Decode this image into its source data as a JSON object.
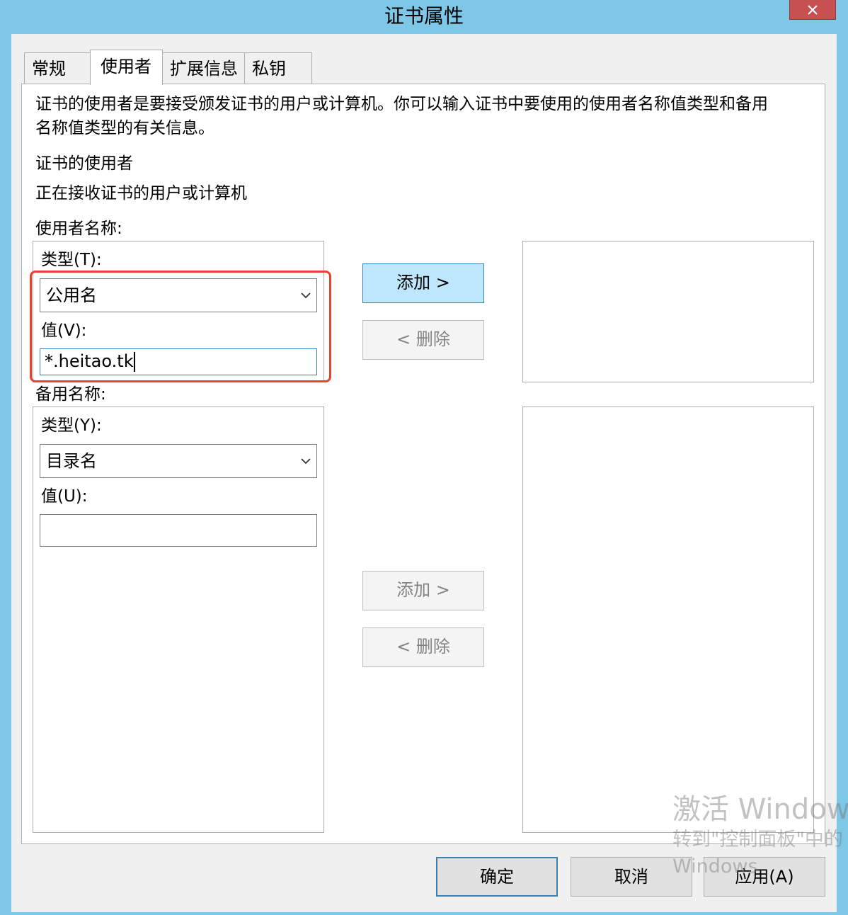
{
  "window": {
    "title": "证书属性",
    "close_glyph": "x"
  },
  "tabs": [
    {
      "label": "常规",
      "active": false
    },
    {
      "label": "使用者",
      "active": true
    },
    {
      "label": "扩展信息",
      "active": false
    },
    {
      "label": "私钥",
      "active": false
    }
  ],
  "intro": {
    "line1": "证书的使用者是要接受颁发证书的用户或计算机。你可以输入证书中要使用的使用者名称值类型和备用",
    "line2": "名称值类型的有关信息。"
  },
  "subject": {
    "heading": "证书的使用者",
    "description": "正在接收证书的用户或计算机"
  },
  "subject_name": {
    "label": "使用者名称:",
    "type_label": "类型(T):",
    "type_value": "公用名",
    "value_label": "值(V):",
    "value": "*.heitao.tk",
    "add_button": "添加 >",
    "remove_button": "< 删除"
  },
  "alt_name": {
    "label": "备用名称:",
    "type_label": "类型(Y):",
    "type_value": "目录名",
    "value_label": "值(U):",
    "value": "",
    "add_button": "添加 >",
    "remove_button": "< 删除"
  },
  "footer": {
    "ok": "确定",
    "cancel": "取消",
    "apply": "应用(A)"
  },
  "watermark": {
    "line1": "激活 Windows",
    "line2": "转到\"控制面板\"中的",
    "line3": "Windows"
  },
  "colors": {
    "titlebar": "#7ec7e6",
    "highlight": "#e8432e",
    "primary_button": "#bee6fd",
    "focus_border": "#3c7fb1"
  }
}
